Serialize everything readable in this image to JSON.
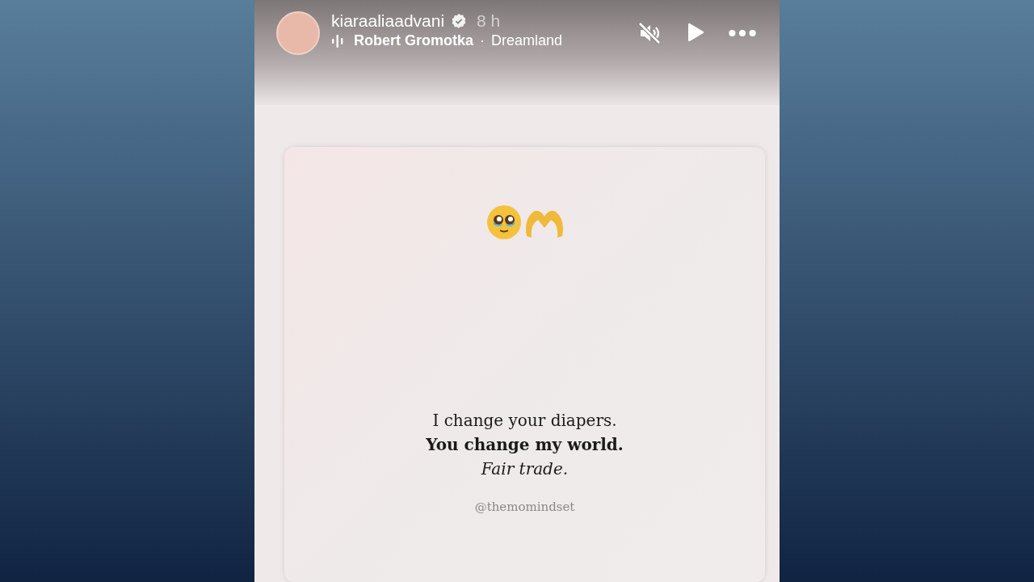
{
  "header": {
    "username": "kiaraaliaadvani",
    "verified": true,
    "time": "8 h",
    "audio": {
      "artist": "Robert Gromotka",
      "separator": "·",
      "track": "Dreamland"
    },
    "muted": true
  },
  "post": {
    "lines": [
      {
        "kind": "regular",
        "text": "I change your diapers."
      },
      {
        "kind": "bold",
        "text": "You change my world."
      },
      {
        "kind": "italic",
        "text": "Fair trade."
      }
    ],
    "handle": "@themomindset"
  }
}
